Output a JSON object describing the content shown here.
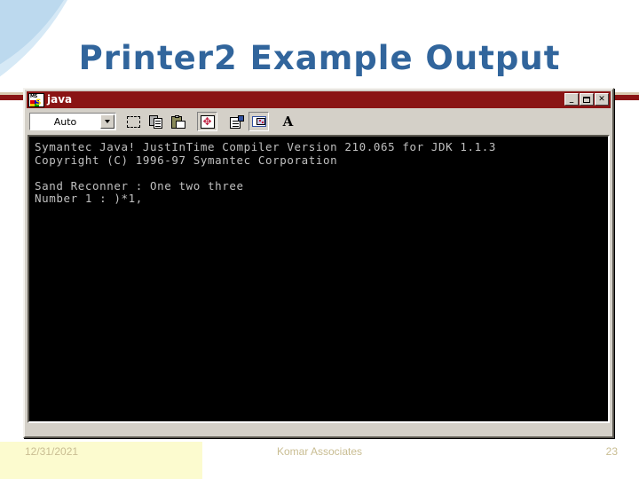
{
  "slide": {
    "title": "Printer2 Example Output",
    "title_color": "#31659c",
    "divider_color": "#8a1414",
    "accent_yellow": "#fcfbcf",
    "accent_blue": "#bcd9ee"
  },
  "console_window": {
    "titlebar": {
      "icon_name": "ms-dos-icon",
      "icon_label": "MS",
      "title": "java",
      "buttons": [
        {
          "name": "minimize-button",
          "glyph": "_"
        },
        {
          "name": "maximize-button",
          "glyph": ""
        },
        {
          "name": "close-button",
          "glyph": "✕"
        }
      ]
    },
    "toolbar": {
      "font_size_combo": {
        "value": "Auto",
        "placeholder": "Auto"
      },
      "buttons": [
        {
          "name": "mark-button",
          "icon": "marquee-select-icon"
        },
        {
          "name": "copy-button",
          "icon": "copy-icon"
        },
        {
          "name": "paste-button",
          "icon": "paste-icon"
        },
        {
          "name": "full-screen-button",
          "icon": "fullscreen-arrows-icon"
        },
        {
          "name": "properties-button",
          "icon": "properties-icon"
        },
        {
          "name": "background-button",
          "icon": "background-window-icon"
        },
        {
          "name": "font-button",
          "icon": "font-a-icon"
        }
      ]
    },
    "screen": {
      "text_color": "#c0c0c0",
      "background_color": "#000000",
      "lines": [
        "Symantec Java! JustInTime Compiler Version 210.065 for JDK 1.1.3",
        "Copyright (C) 1996-97 Symantec Corporation",
        "",
        "Sand Reconner : One two three",
        "Number 1 : )*1,"
      ]
    }
  },
  "footer": {
    "date": "12/31/2021",
    "center": "Komar Associates",
    "page": "23"
  }
}
